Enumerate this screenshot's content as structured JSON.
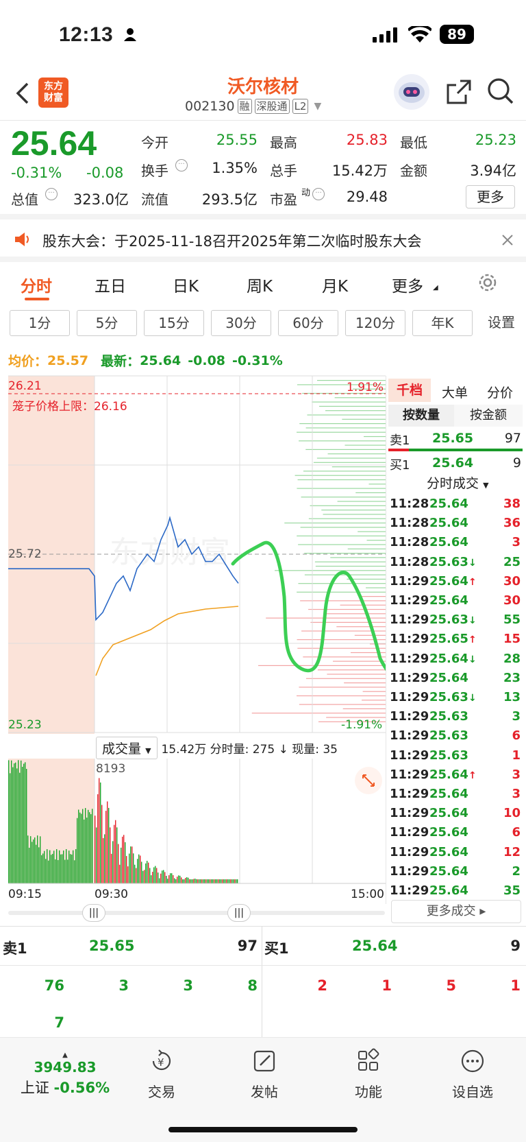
{
  "status_bar": {
    "time": "12:13",
    "battery": "89"
  },
  "header": {
    "logo_line1": "东方",
    "logo_line2": "财富",
    "title": "沃尔核材",
    "code": "002130",
    "tags": [
      "融",
      "深股通",
      "L2"
    ]
  },
  "quote": {
    "price": "25.64",
    "change_pct": "-0.31%",
    "change": "-0.08",
    "fields": [
      {
        "label": "今开",
        "value": "25.55"
      },
      {
        "label": "最高",
        "value": "25.83"
      },
      {
        "label": "最低",
        "value": "25.23"
      },
      {
        "label": "换手",
        "value": "1.35%"
      },
      {
        "label": "总手",
        "value": "15.42万"
      },
      {
        "label": "金额",
        "value": "3.94亿"
      },
      {
        "label": "总值",
        "value": "323.0亿"
      },
      {
        "label": "流值",
        "value": "293.5亿"
      },
      {
        "label": "市盈",
        "value": "29.48"
      }
    ],
    "pe_sup": "动",
    "more_button": "更多"
  },
  "notice": {
    "text": "股东大会：于2025-11-18召开2025年第二次临时股东大会"
  },
  "tabs": [
    "分时",
    "五日",
    "日K",
    "周K",
    "月K",
    "更多"
  ],
  "period_tabs": [
    "1分",
    "5分",
    "15分",
    "30分",
    "60分",
    "120分",
    "年K",
    "设置"
  ],
  "info": {
    "avg_label": "均价：",
    "avg": "25.57",
    "last_label": "最新：",
    "last": "25.64",
    "chg": "-0.08",
    "pct": "-0.31%"
  },
  "chart": {
    "y_high": "26.21",
    "y_mid": "25.72",
    "y_low": "25.23",
    "pct_high": "1.91%",
    "pct_low": "-1.91%",
    "cage_label": "笼子价格上限：26.16",
    "vol_label": "成交量",
    "vol_info": "15.42万 分时量: 275 ↓ 现量: 35",
    "vol_max": "8193",
    "t_start": "09:15",
    "t_mid": "09:30",
    "t_end": "15:00",
    "watermark": "东方财富"
  },
  "chart_data": {
    "type": "line",
    "title": "",
    "x_range": [
      "09:15",
      "15:00"
    ],
    "ylim": [
      25.23,
      26.21
    ],
    "series": [
      {
        "name": "",
        "values": [
          25.68,
          25.68,
          25.68,
          25.68,
          25.66,
          25.54,
          25.56,
          25.6,
          25.64,
          25.66,
          25.62,
          25.68,
          25.72,
          25.7,
          25.76,
          25.8,
          25.82,
          25.74,
          25.76,
          25.72,
          25.74,
          25.7,
          25.7,
          25.72,
          25.69,
          25.66,
          25.64
        ]
      }
    ]
  },
  "side": {
    "tabs": [
      "千档",
      "大单",
      "分价"
    ],
    "sub_tabs": [
      "按数量",
      "按金额"
    ],
    "ask1": {
      "label": "卖1",
      "price": "25.65",
      "vol": "97"
    },
    "bid1": {
      "label": "买1",
      "price": "25.64",
      "vol": "9"
    },
    "trades_title": "分时成交",
    "more": "更多成交",
    "trades": [
      [
        "11:28",
        "25.64",
        "",
        "38",
        "r"
      ],
      [
        "11:28",
        "25.64",
        "",
        "36",
        "r"
      ],
      [
        "11:28",
        "25.64",
        "",
        "3",
        "r"
      ],
      [
        "11:28",
        "25.63",
        "↓",
        "25",
        "g"
      ],
      [
        "11:29",
        "25.64",
        "↑",
        "30",
        "r"
      ],
      [
        "11:29",
        "25.64",
        "",
        "30",
        "r"
      ],
      [
        "11:29",
        "25.63",
        "↓",
        "55",
        "g"
      ],
      [
        "11:29",
        "25.65",
        "↑",
        "15",
        "r"
      ],
      [
        "11:29",
        "25.64",
        "↓",
        "28",
        "g"
      ],
      [
        "11:29",
        "25.64",
        "",
        "23",
        "g"
      ],
      [
        "11:29",
        "25.63",
        "↓",
        "13",
        "g"
      ],
      [
        "11:29",
        "25.63",
        "",
        "3",
        "g"
      ],
      [
        "11:29",
        "25.63",
        "",
        "6",
        "r"
      ],
      [
        "11:29",
        "25.63",
        "",
        "1",
        "r"
      ],
      [
        "11:29",
        "25.64",
        "↑",
        "3",
        "r"
      ],
      [
        "11:29",
        "25.64",
        "",
        "3",
        "r"
      ],
      [
        "11:29",
        "25.64",
        "",
        "10",
        "r"
      ],
      [
        "11:29",
        "25.64",
        "",
        "6",
        "r"
      ],
      [
        "11:29",
        "25.64",
        "",
        "12",
        "r"
      ],
      [
        "11:29",
        "25.64",
        "",
        "2",
        "g"
      ],
      [
        "11:29",
        "25.64",
        "",
        "35",
        "g"
      ]
    ]
  },
  "book": {
    "ask_label": "卖1",
    "ask_price": "25.65",
    "ask_vol": "97",
    "bid_label": "买1",
    "bid_price": "25.64",
    "bid_vol": "9",
    "ask_queue": [
      "76",
      "3",
      "3",
      "8",
      "7"
    ],
    "bid_queue": [
      "2",
      "1",
      "5",
      "1"
    ]
  },
  "bottom": {
    "index": "3949.83",
    "index_name": "上证",
    "index_pct": "-0.56%",
    "items": [
      "交易",
      "发帖",
      "功能",
      "设自选"
    ]
  }
}
